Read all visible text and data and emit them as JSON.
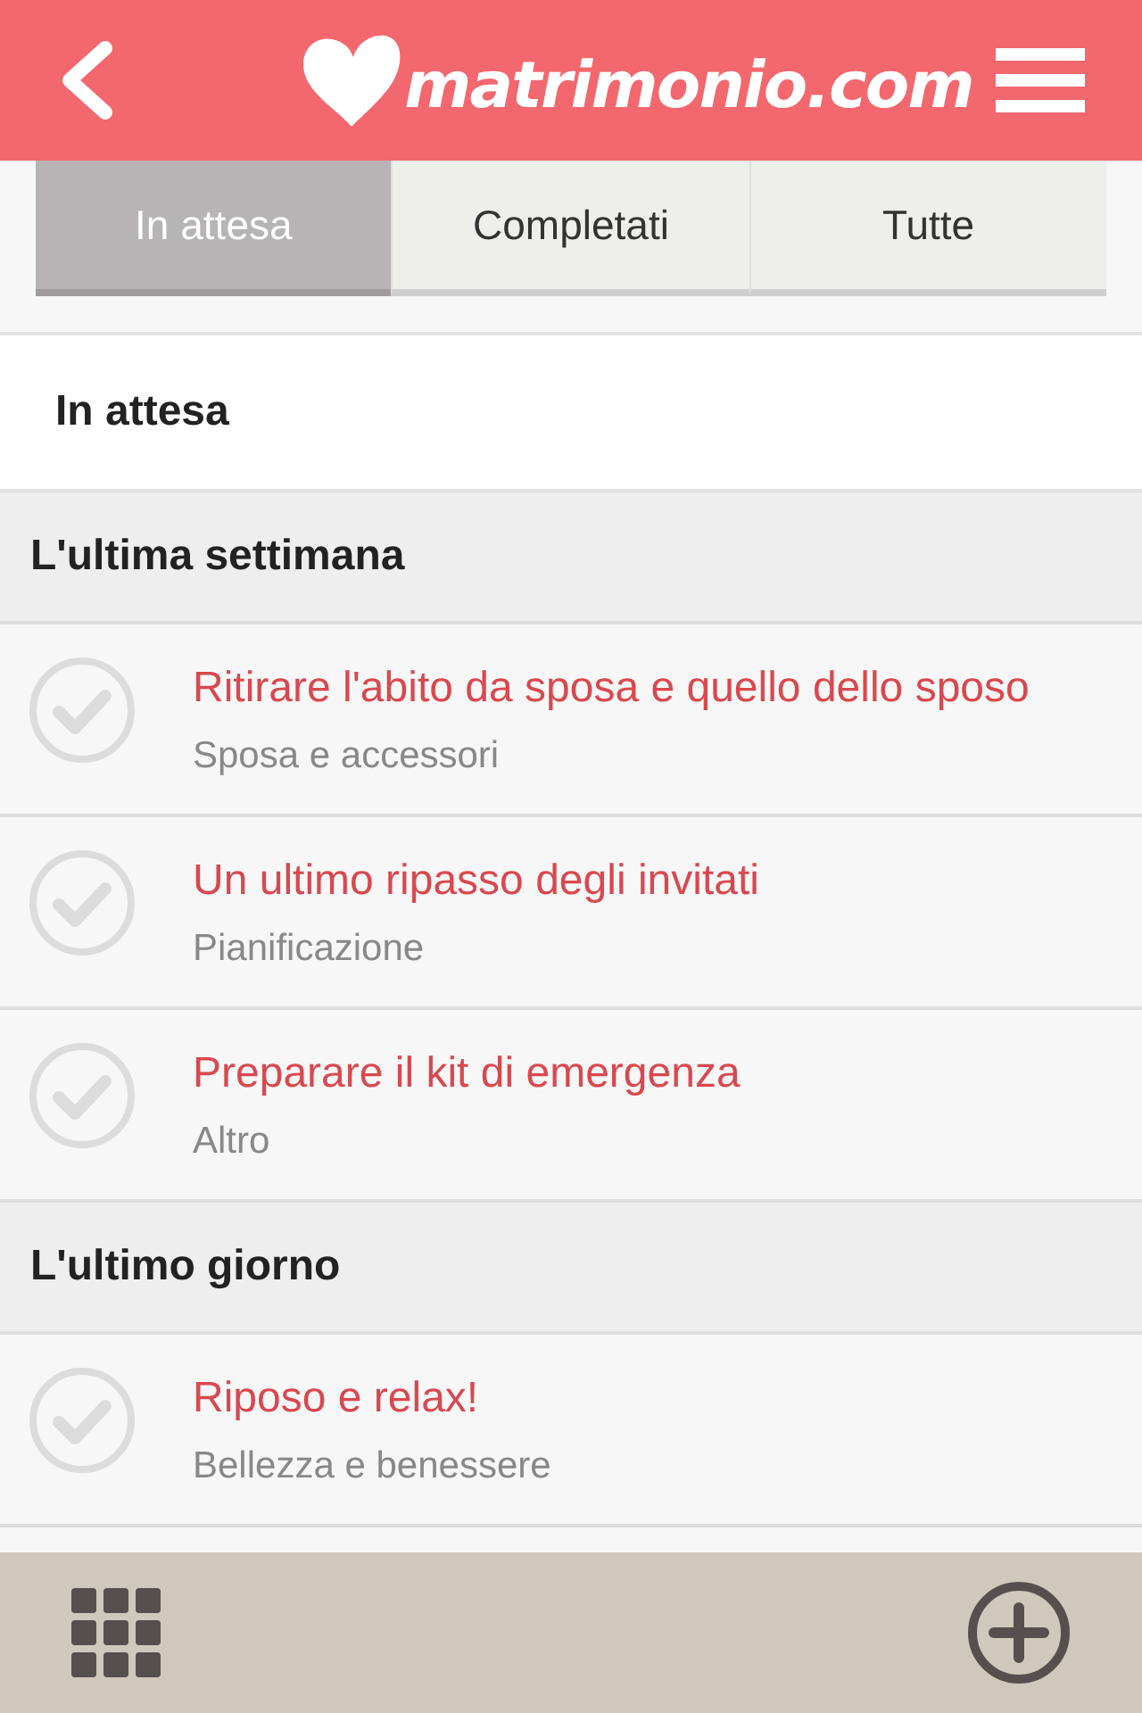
{
  "header": {
    "logo": "matrimonio.com"
  },
  "tabs": [
    {
      "label": "In attesa",
      "selected": true
    },
    {
      "label": "Completati",
      "selected": false
    },
    {
      "label": "Tutte",
      "selected": false
    }
  ],
  "section_title": "In attesa",
  "groups": [
    {
      "title": "L'ultima settimana",
      "tasks": [
        {
          "title": "Ritirare l'abito da sposa e quello dello sposo",
          "category": "Sposa e accessori",
          "checked": false
        },
        {
          "title": "Un ultimo ripasso degli invitati",
          "category": "Pianificazione",
          "checked": false
        },
        {
          "title": "Preparare il kit di emergenza",
          "category": "Altro",
          "checked": false
        }
      ]
    },
    {
      "title": "L'ultimo giorno",
      "tasks": [
        {
          "title": "Riposo e relax!",
          "category": "Bellezza e benessere",
          "checked": false
        }
      ]
    }
  ]
}
